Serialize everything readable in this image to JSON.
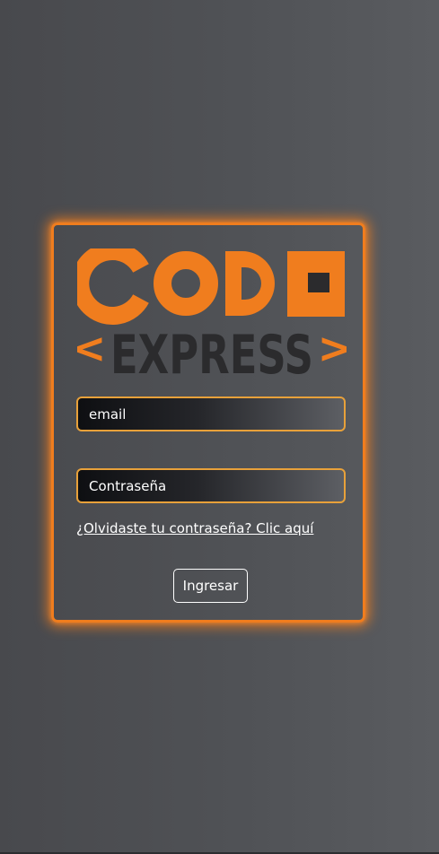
{
  "brand": {
    "logo_line1": "CODE",
    "logo_line2": "EXPRESS",
    "logo_bracket_left": "<",
    "logo_bracket_right": ">",
    "accent_color": "#f07d1e",
    "logo_dark_color": "#2b2b2d"
  },
  "login_form": {
    "email_placeholder": "email",
    "password_placeholder": "Contraseña",
    "forgot_password_link": "¿Olvidaste tu contraseña? Clic aquí",
    "submit_label": "Ingresar"
  }
}
